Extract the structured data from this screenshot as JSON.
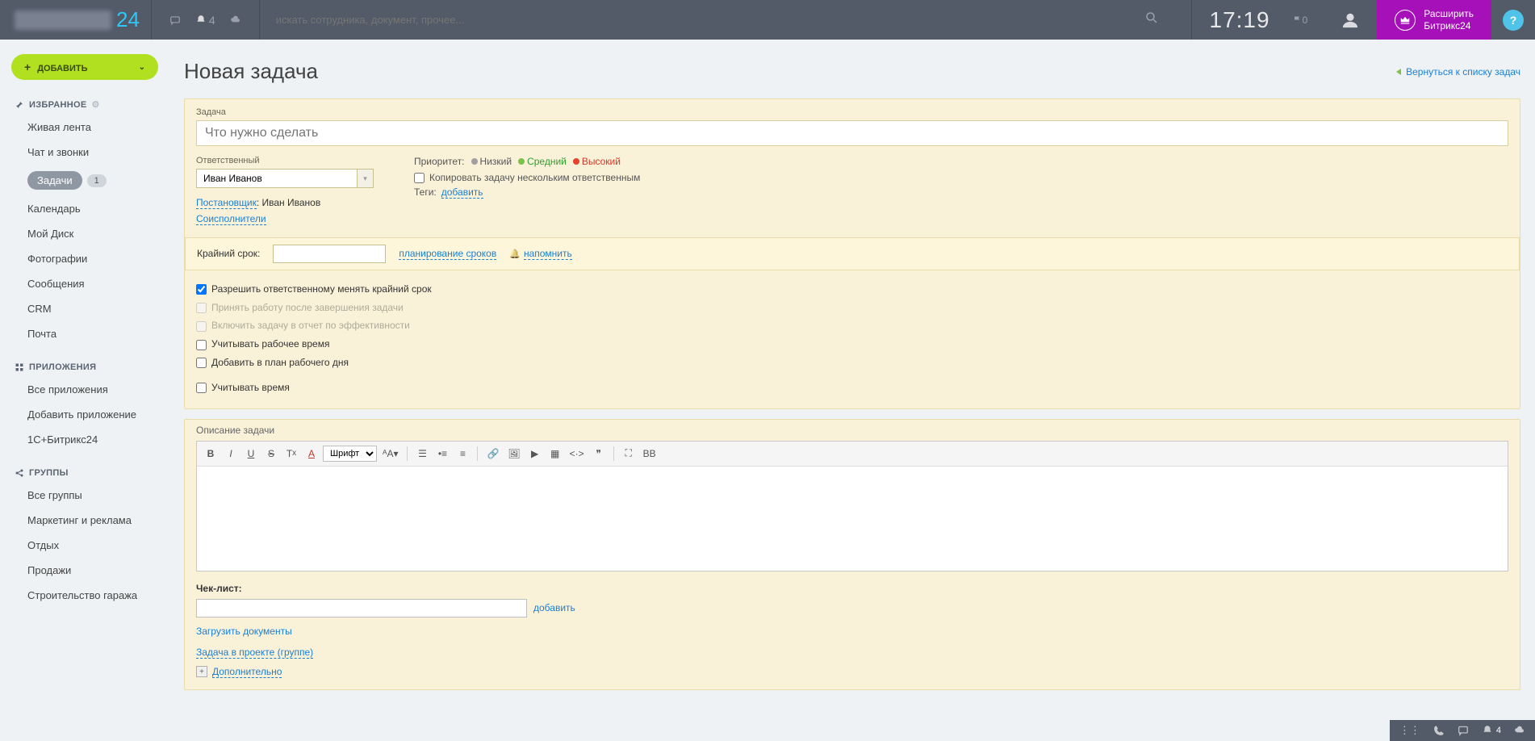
{
  "header": {
    "logo_number": "24",
    "bell_count": "4",
    "search_placeholder": "искать сотрудника, документ, прочее...",
    "time": "17:19",
    "flag_count": "0",
    "expand_line1": "Расширить",
    "expand_line2": "Битрикс24",
    "help": "?"
  },
  "sidebar": {
    "add_button": "ДОБАВИТЬ",
    "favorites_title": "ИЗБРАННОЕ",
    "favorites": [
      {
        "label": "Живая лента"
      },
      {
        "label": "Чат и звонки"
      },
      {
        "label": "Задачи",
        "badge": "1",
        "active": true
      },
      {
        "label": "Календарь"
      },
      {
        "label": "Мой Диск"
      },
      {
        "label": "Фотографии"
      },
      {
        "label": "Сообщения"
      },
      {
        "label": "CRM"
      },
      {
        "label": "Почта"
      }
    ],
    "apps_title": "ПРИЛОЖЕНИЯ",
    "apps": [
      {
        "label": "Все приложения"
      },
      {
        "label": "Добавить приложение"
      },
      {
        "label": "1С+Битрикс24"
      }
    ],
    "groups_title": "ГРУППЫ",
    "groups": [
      {
        "label": "Все группы"
      },
      {
        "label": "Маркетинг и реклама"
      },
      {
        "label": "Отдых"
      },
      {
        "label": "Продажи"
      },
      {
        "label": "Строительство гаража"
      }
    ]
  },
  "page": {
    "title": "Новая задача",
    "back_link": "Вернуться к списку задач"
  },
  "task": {
    "label_task": "Задача",
    "placeholder_task": "Что нужно сделать",
    "label_responsible": "Ответственный",
    "responsible_value": "Иван Иванов",
    "poster_label": "Постановщик",
    "poster_value": "Иван Иванов",
    "coexecutors": "Соисполнители",
    "priority_label": "Приоритет:",
    "priority_low": "Низкий",
    "priority_mid": "Средний",
    "priority_high": "Высокий",
    "copy_multiple": "Копировать задачу нескольким ответственным",
    "tags_label": "Теги:",
    "tags_add": "добавить",
    "deadline_label": "Крайний срок:",
    "planning_link": "планирование сроков",
    "remind_link": "напомнить",
    "checks": {
      "c1": "Разрешить ответственному менять крайний срок",
      "c2": "Принять работу после завершения задачи",
      "c3": "Включить задачу в отчет по эффективности",
      "c4": "Учитывать рабочее время",
      "c5": "Добавить в план рабочего дня",
      "c6": "Учитывать время"
    },
    "desc_label": "Описание задачи",
    "font_label": "Шрифт",
    "checklist_label": "Чек-лист:",
    "checklist_add": "добавить",
    "upload_docs": "Загрузить документы",
    "project_link": "Задача в проекте (группе)",
    "extra_label": "Дополнительно"
  },
  "bottombar": {
    "bell_count": "4"
  }
}
